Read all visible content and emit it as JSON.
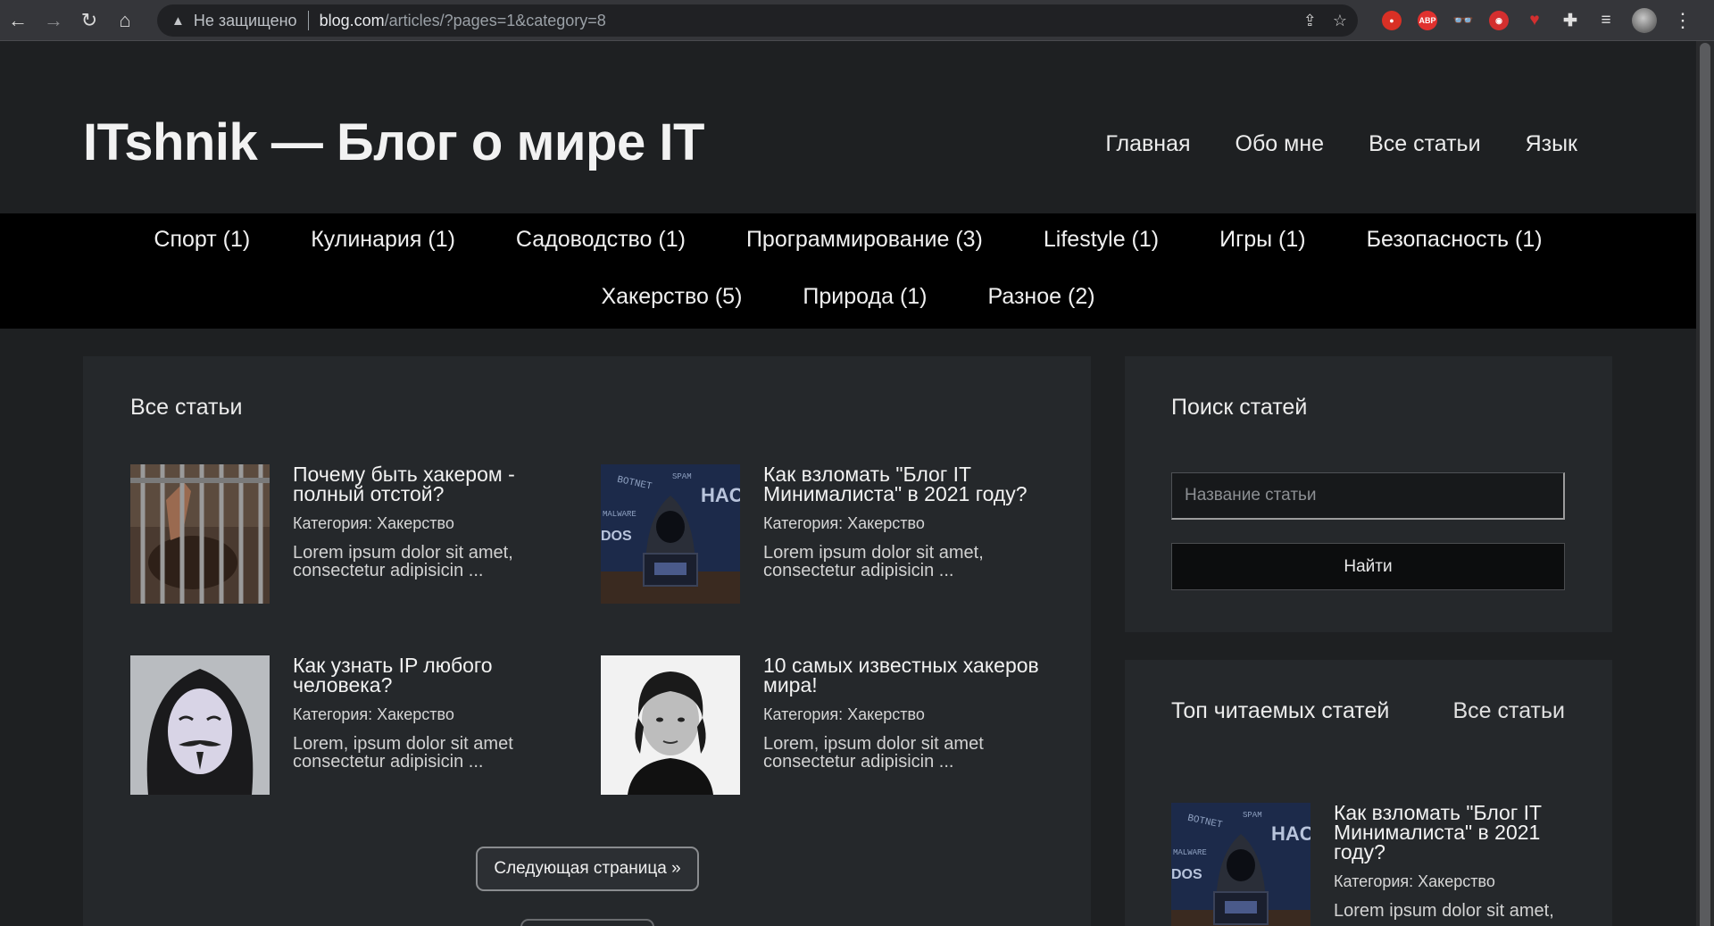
{
  "browser": {
    "insecure_label": "Не защищено",
    "url_host": "blog.com",
    "url_path": "/articles/?pages=1&category=8",
    "extensions": [
      {
        "icon": "red-circle-extension-icon",
        "color": "#d93025",
        "text": ""
      },
      {
        "icon": "adblock-plus-icon",
        "color": "#e0312e",
        "text": "ABP"
      },
      {
        "icon": "glasses-extension-icon",
        "color": "transparent",
        "text": ""
      },
      {
        "icon": "red-shield-extension-icon",
        "color": "#d32f2f",
        "text": ""
      },
      {
        "icon": "red-heart-extension-icon",
        "color": "#c62828",
        "text": ""
      }
    ]
  },
  "site": {
    "title": "ITshnik — Блог о мире IT",
    "nav": [
      "Главная",
      "Обо мне",
      "Все статьи",
      "Язык"
    ]
  },
  "categories": {
    "row1": [
      "Спорт (1)",
      "Кулинария (1)",
      "Садоводство (1)",
      "Программирование (3)",
      "Lifestyle (1)",
      "Игры (1)",
      "Безопасность (1)"
    ],
    "row2": [
      "Хакерство (5)",
      "Природа (1)",
      "Разное (2)"
    ]
  },
  "main": {
    "title": "Все статьи",
    "articles": [
      {
        "title": "Почему быть хакером - полный отстой?",
        "category": "Категория: Хакерство",
        "excerpt": "Lorem ipsum dolor sit amet, consectetur adipisicin ...",
        "image": "prison-bars-photo"
      },
      {
        "title": "Как взломать \"Блог IT Минималиста\" в 2021 году?",
        "category": "Категория: Хакерство",
        "excerpt": "Lorem ipsum dolor sit amet, consectetur adipisicin ...",
        "image": "hooded-hacker-photo"
      },
      {
        "title": "Как узнать IP любого человека?",
        "category": "Категория: Хакерство",
        "excerpt": "Lorem, ipsum dolor sit amet consectetur adipisicin ...",
        "image": "guy-fawkes-mask-photo"
      },
      {
        "title": "10 самых известных хакеров мира!",
        "category": "Категория: Хакерство",
        "excerpt": "Lorem, ipsum dolor sit amet consectetur adipisicin ...",
        "image": "portrait-photo"
      }
    ],
    "next_page": "Следующая страница »"
  },
  "sidebar": {
    "search": {
      "title": "Поиск статей",
      "placeholder": "Название статьи",
      "button": "Найти"
    },
    "top": {
      "title": "Топ читаемых статей",
      "all_link": "Все статьи",
      "article": {
        "title": "Как взломать \"Блог IT Минималиста\" в 2021 году?",
        "category": "Категория: Хакерство",
        "excerpt": "Lorem ipsum dolor sit amet,",
        "image": "hooded-hacker-photo"
      }
    }
  }
}
